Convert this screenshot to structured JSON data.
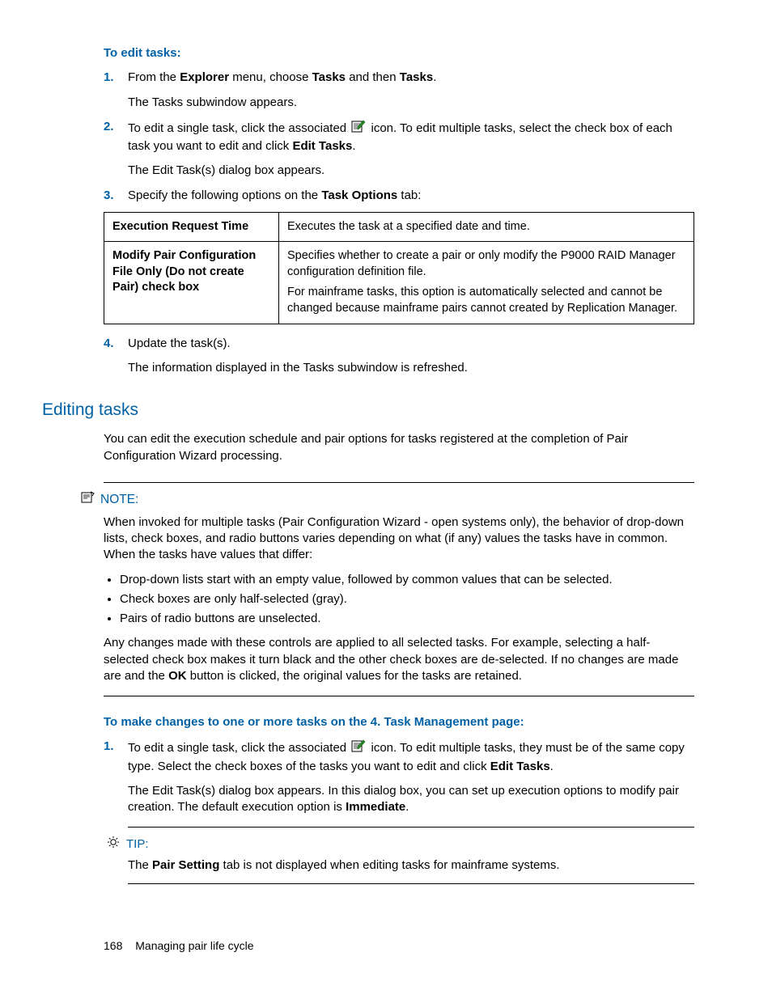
{
  "section1": {
    "heading": "To edit tasks:",
    "steps": [
      {
        "num": "1.",
        "paragraphs": [
          {
            "segments": [
              {
                "t": "From the "
              },
              {
                "t": "Explorer",
                "b": true
              },
              {
                "t": " menu, choose "
              },
              {
                "t": "Tasks",
                "b": true
              },
              {
                "t": " and then "
              },
              {
                "t": "Tasks",
                "b": true
              },
              {
                "t": "."
              }
            ]
          },
          {
            "segments": [
              {
                "t": "The Tasks subwindow appears."
              }
            ]
          }
        ]
      },
      {
        "num": "2.",
        "paragraphs": [
          {
            "segments": [
              {
                "t": "To edit a single task, click the associated "
              },
              {
                "icon": "edit"
              },
              {
                "t": " icon. To edit multiple tasks, select the check box of each task you want to edit and click "
              },
              {
                "t": "Edit Tasks",
                "b": true
              },
              {
                "t": "."
              }
            ]
          },
          {
            "segments": [
              {
                "t": "The Edit Task(s) dialog box appears."
              }
            ]
          }
        ]
      },
      {
        "num": "3.",
        "paragraphs": [
          {
            "segments": [
              {
                "t": "Specify the following options on the "
              },
              {
                "t": "Task Options",
                "b": true
              },
              {
                "t": " tab:"
              }
            ]
          }
        ]
      }
    ],
    "table": [
      {
        "label": "Execution Request Time",
        "desc": [
          "Executes the task at a specified date and time."
        ]
      },
      {
        "label": "Modify Pair Configuration File Only (Do not create Pair) check box",
        "desc": [
          "Specifies whether to create a pair or only modify the P9000 RAID Manager configuration definition file.",
          "For mainframe tasks, this option is automatically selected and cannot be changed because mainframe pairs cannot created by Replication Manager."
        ]
      }
    ],
    "step4": {
      "num": "4.",
      "paragraphs": [
        {
          "segments": [
            {
              "t": "Update the task(s)."
            }
          ]
        },
        {
          "segments": [
            {
              "t": "The information displayed in the Tasks subwindow is refreshed."
            }
          ]
        }
      ]
    }
  },
  "section2": {
    "title": "Editing tasks",
    "intro": "You can edit the execution schedule and pair options for tasks registered at the completion of Pair Configuration Wizard processing.",
    "note": {
      "label": "NOTE:",
      "p1": "When invoked for multiple tasks (Pair Configuration Wizard - open systems only), the behavior of drop-down lists, check boxes, and radio buttons varies depending on what (if any) values the tasks have in common. When the tasks have values that differ:",
      "bullets": [
        "Drop-down lists start with an empty value, followed by common values that can be selected.",
        "Check boxes are only half-selected (gray).",
        "Pairs of radio buttons are unselected."
      ],
      "p2": {
        "segments": [
          {
            "t": "Any changes made with these controls are applied to all selected tasks. For example, selecting a half-selected check box makes it turn black and the other check boxes are de-selected. If no changes are made are and the "
          },
          {
            "t": "OK",
            "b": true
          },
          {
            "t": " button is clicked, the original values for the tasks are retained."
          }
        ]
      }
    },
    "heading2": "To make changes to one or more tasks on the 4. Task Management page:",
    "steps2": [
      {
        "num": "1.",
        "paragraphs": [
          {
            "segments": [
              {
                "t": "To edit a single task, click the associated "
              },
              {
                "icon": "edit"
              },
              {
                "t": " icon. To edit multiple tasks, they must be of the same copy type. Select the check boxes of the tasks you want to edit and click "
              },
              {
                "t": "Edit Tasks",
                "b": true
              },
              {
                "t": "."
              }
            ]
          },
          {
            "segments": [
              {
                "t": "The Edit Task(s) dialog box appears. In this dialog box, you can set up execution options to modify pair creation. The default execution option is "
              },
              {
                "t": "Immediate",
                "b": true
              },
              {
                "t": "."
              }
            ]
          }
        ]
      }
    ],
    "tip": {
      "label": "TIP:",
      "body": {
        "segments": [
          {
            "t": "The "
          },
          {
            "t": "Pair Setting",
            "b": true
          },
          {
            "t": " tab is not displayed when editing tasks for mainframe systems."
          }
        ]
      }
    }
  },
  "footer": {
    "page": "168",
    "chapter": "Managing pair life cycle"
  }
}
